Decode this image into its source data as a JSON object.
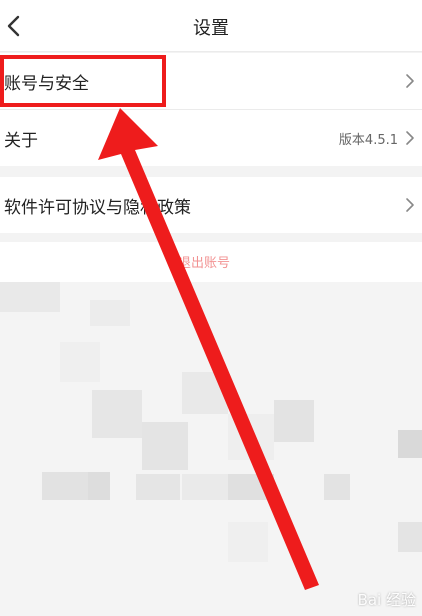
{
  "header": {
    "title": "设置"
  },
  "settings": {
    "account_security": "账号与安全",
    "about": "关于",
    "version": "版本4.5.1",
    "license_privacy": "软件许可协议与隐私政策"
  },
  "logout": {
    "label": "退出账号"
  },
  "annotation": {
    "highlight_color": "#ee1c1c"
  },
  "watermark": {
    "text": "Bai 经验"
  }
}
